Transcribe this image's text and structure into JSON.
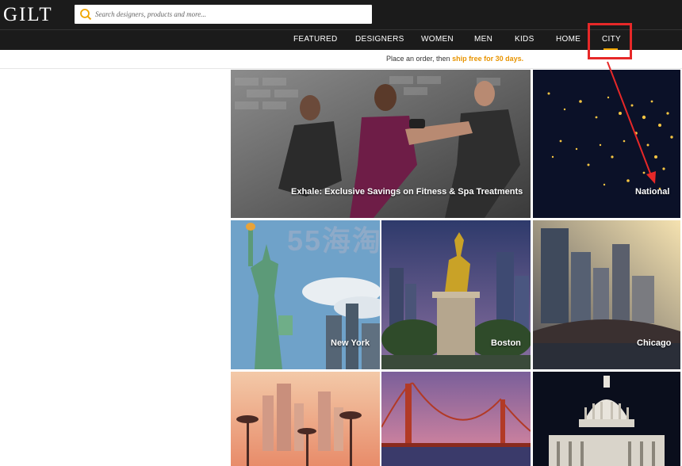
{
  "header": {
    "logo": "GILT",
    "search": {
      "placeholder": "Search designers, products and more...",
      "value": ""
    }
  },
  "nav": {
    "items": [
      {
        "label": "FEATURED"
      },
      {
        "label": "DESIGNERS"
      },
      {
        "label": "WOMEN"
      },
      {
        "label": "MEN"
      },
      {
        "label": "KIDS"
      },
      {
        "label": "HOME"
      },
      {
        "label": "CITY",
        "active": true
      }
    ],
    "accent_color": "#f0a500"
  },
  "promo": {
    "prefix": "Place an order, then ",
    "link": "ship free for 30 days."
  },
  "tiles": [
    {
      "label": "Exhale: Exclusive Savings on Fitness & Spa Treatments"
    },
    {
      "label": "National"
    },
    {
      "label": "New York"
    },
    {
      "label": "Boston"
    },
    {
      "label": "Chicago"
    },
    {
      "label": ""
    },
    {
      "label": ""
    },
    {
      "label": ""
    }
  ],
  "watermark": "55海淘",
  "annotation_color": "#e62828"
}
